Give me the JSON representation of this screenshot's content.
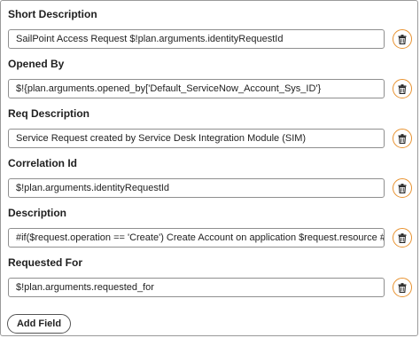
{
  "fields": [
    {
      "label": "Short Description",
      "value": "SailPoint Access Request $!plan.arguments.identityRequestId"
    },
    {
      "label": "Opened By",
      "value": "$!{plan.arguments.opened_by['Default_ServiceNow_Account_Sys_ID'}"
    },
    {
      "label": "Req Description",
      "value": "Service Request created by Service Desk Integration Module (SIM)"
    },
    {
      "label": "Correlation Id",
      "value": "$!plan.arguments.identityRequestId"
    },
    {
      "label": "Description",
      "value": "#if($request.operation == 'Create') Create Account on application $request.resource #elseif($request.c"
    },
    {
      "label": "Requested For",
      "value": "$!plan.arguments.requested_for"
    }
  ],
  "delete_icon": "trash-icon",
  "add_field_label": "Add Field",
  "colors": {
    "delete_accent": "#e8922f",
    "input_border": "#8f8f8f"
  }
}
